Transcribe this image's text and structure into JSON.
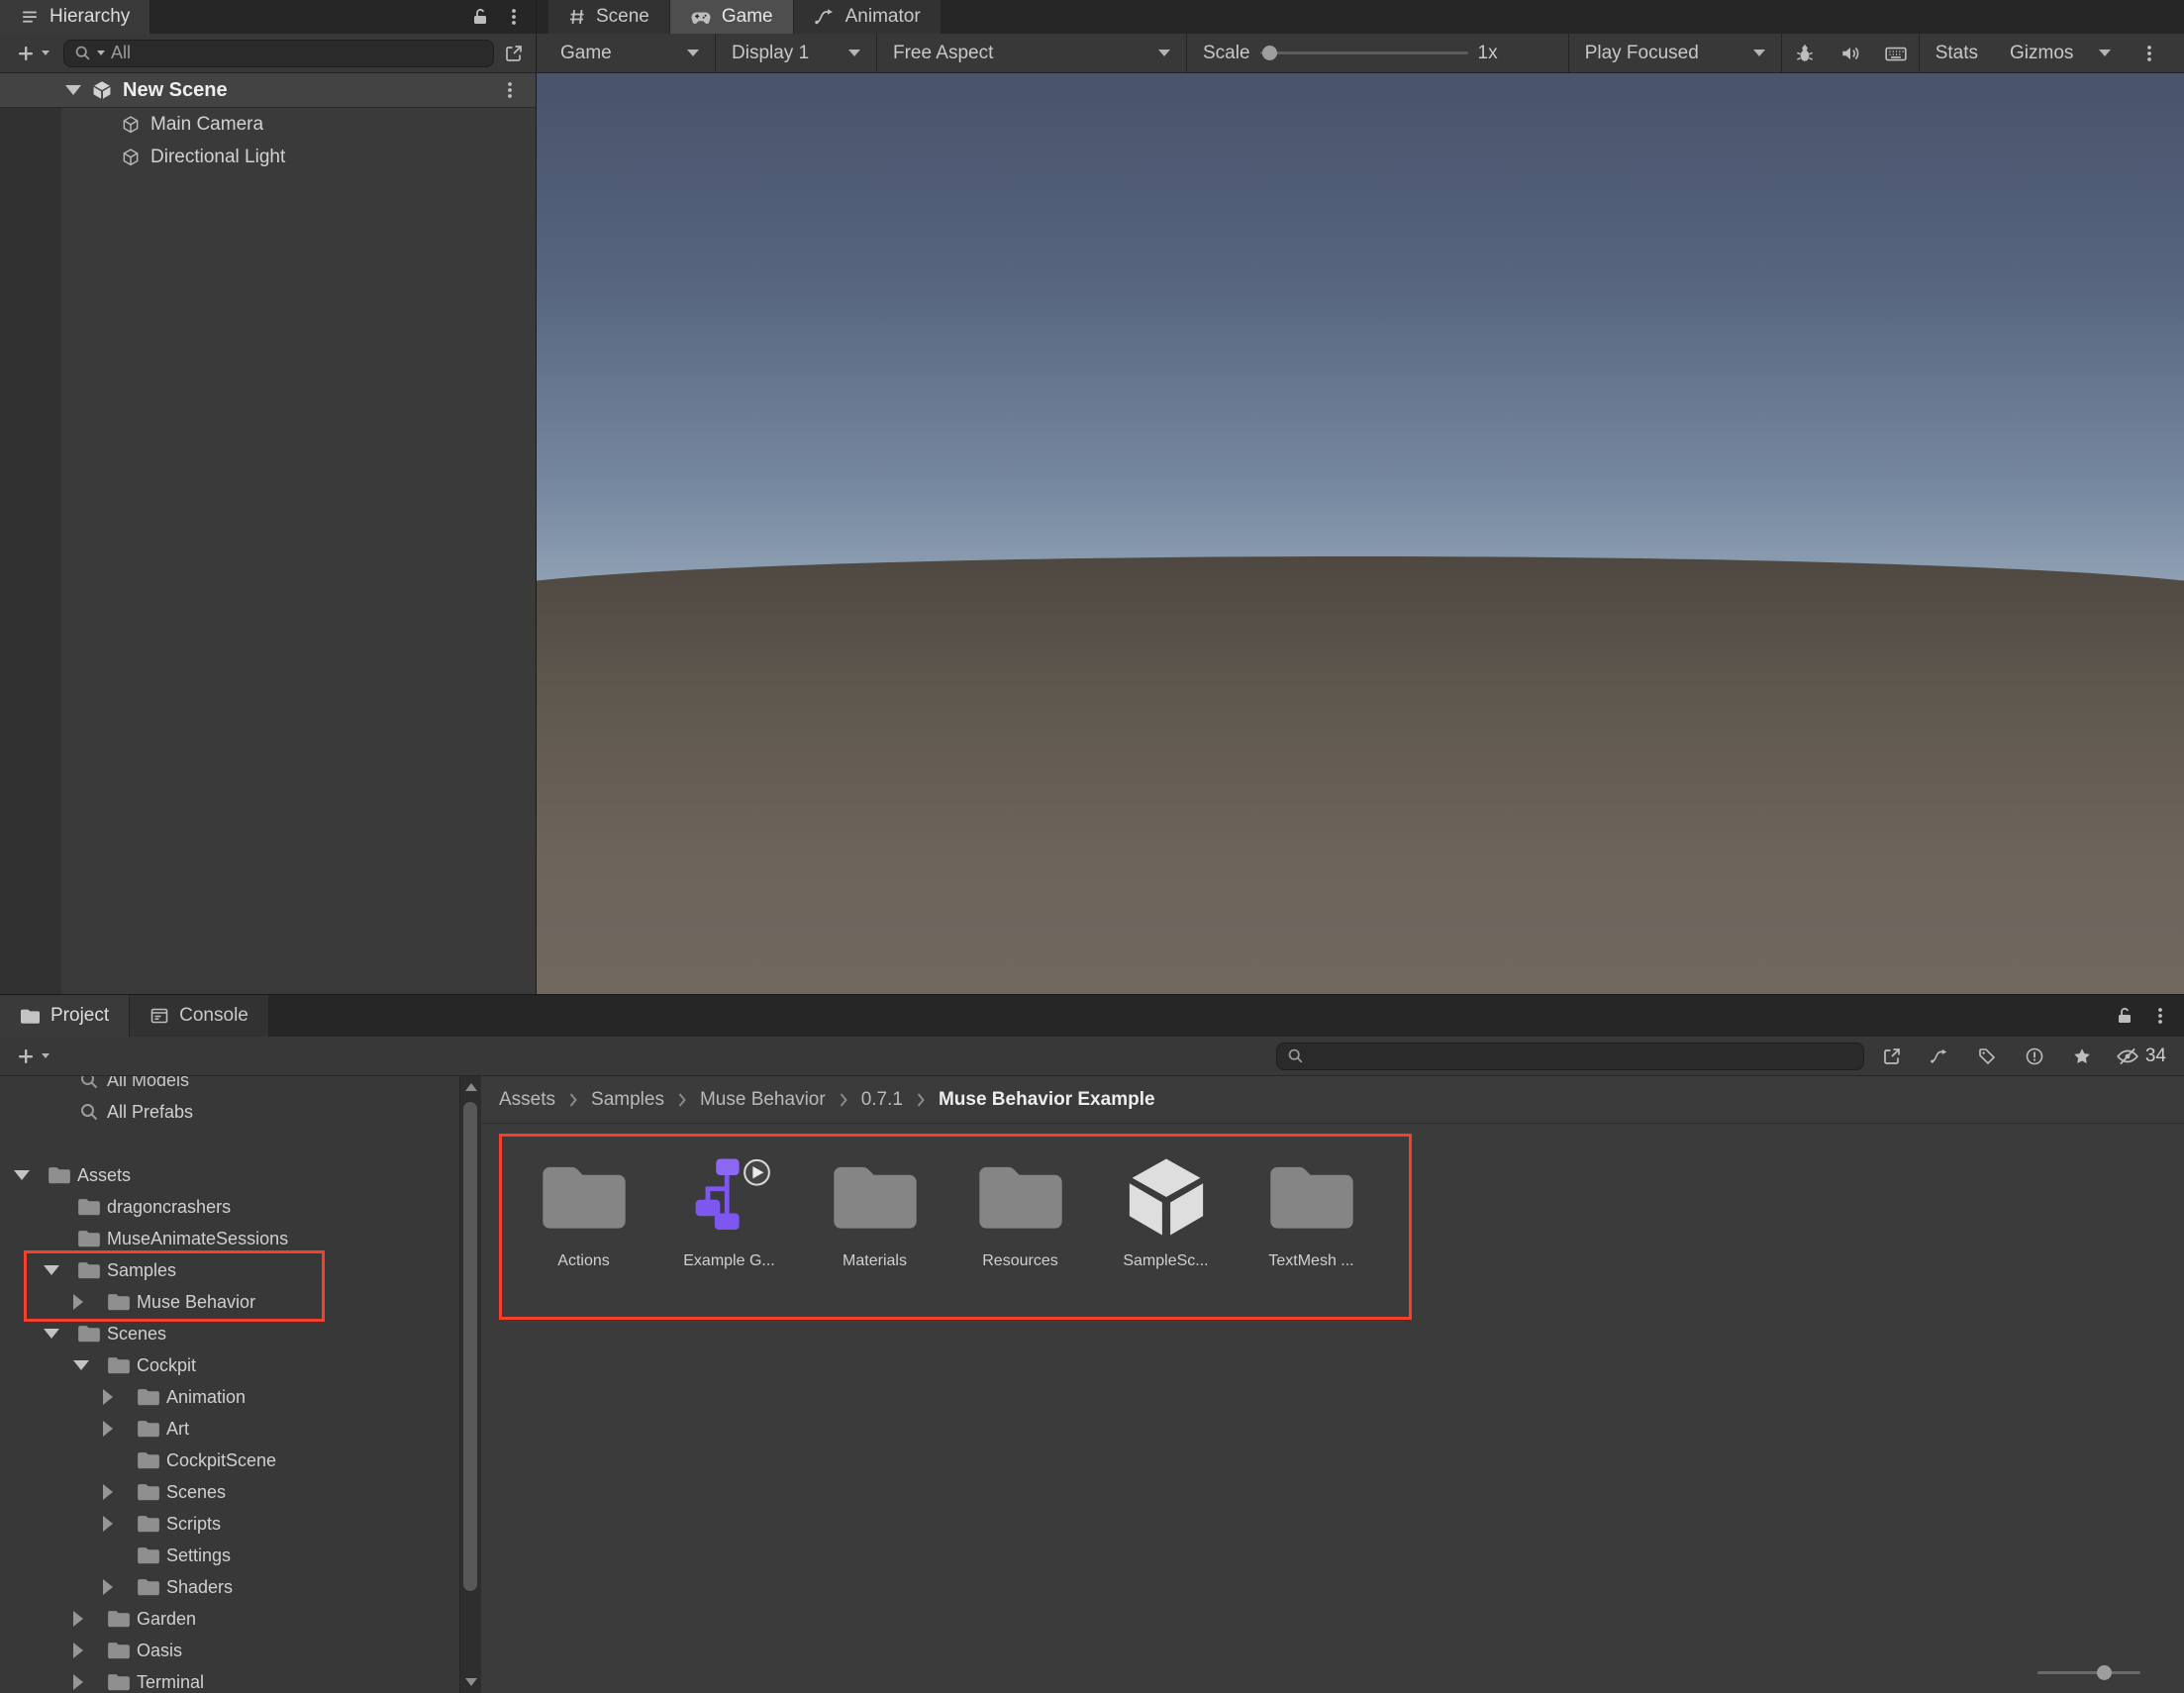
{
  "hierarchy": {
    "tab": "Hierarchy",
    "search_value": "All",
    "scene": "New Scene",
    "items": [
      {
        "label": "Main Camera"
      },
      {
        "label": "Directional Light"
      }
    ]
  },
  "view_tabs": {
    "scene": "Scene",
    "game": "Game",
    "animator": "Animator"
  },
  "game_view": {
    "target": "Game",
    "display": "Display 1",
    "aspect": "Free Aspect",
    "scale_label": "Scale",
    "scale_value": "1x",
    "play_mode": "Play Focused",
    "stats": "Stats",
    "gizmos": "Gizmos"
  },
  "project": {
    "tab_project": "Project",
    "tab_console": "Console",
    "search_value": "",
    "hidden_count": "34",
    "breadcrumbs": [
      {
        "label": "Assets"
      },
      {
        "label": "Samples"
      },
      {
        "label": "Muse Behavior"
      },
      {
        "label": "0.7.1"
      },
      {
        "label": "Muse Behavior Example"
      }
    ],
    "tree": [
      {
        "label": "All Models"
      },
      {
        "label": "All Prefabs"
      },
      {
        "label": "Assets"
      },
      {
        "label": "dragoncrashers"
      },
      {
        "label": "MuseAnimateSessions"
      },
      {
        "label": "Samples"
      },
      {
        "label": "Muse Behavior"
      },
      {
        "label": "Scenes"
      },
      {
        "label": "Cockpit"
      },
      {
        "label": "Animation"
      },
      {
        "label": "Art"
      },
      {
        "label": "CockpitScene"
      },
      {
        "label": "Scenes"
      },
      {
        "label": "Scripts"
      },
      {
        "label": "Settings"
      },
      {
        "label": "Shaders"
      },
      {
        "label": "Garden"
      },
      {
        "label": "Oasis"
      },
      {
        "label": "Terminal"
      }
    ],
    "grid": [
      {
        "label": "Actions"
      },
      {
        "label": "Example G..."
      },
      {
        "label": "Materials"
      },
      {
        "label": "Resources"
      },
      {
        "label": "SampleSc..."
      },
      {
        "label": "TextMesh ..."
      }
    ]
  },
  "colors": {
    "highlight_red": "#f6402c",
    "accent_purple": "#7e57f0"
  }
}
